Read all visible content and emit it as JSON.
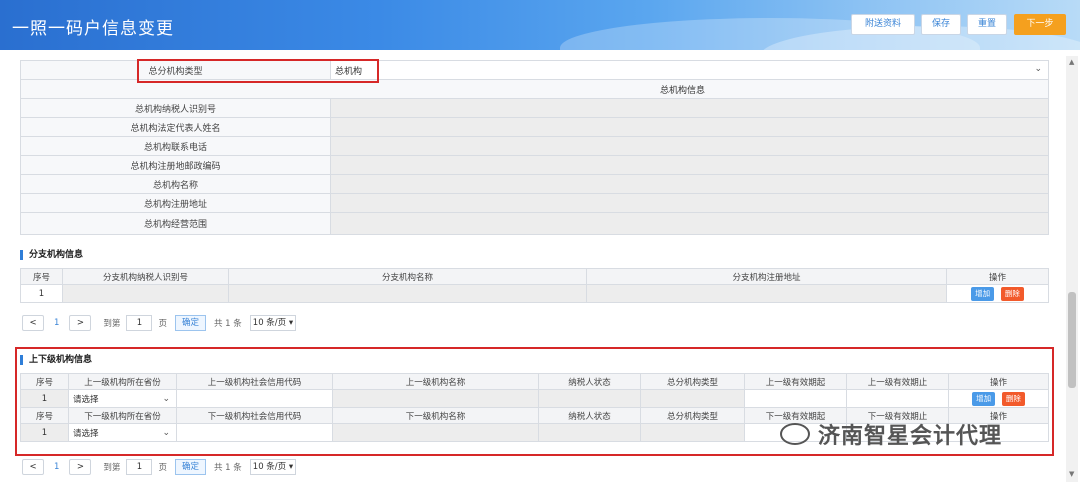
{
  "header": {
    "title": "一照一码户信息变更",
    "buttons": {
      "attach": "附送资料",
      "save": "保存",
      "reset": "重置",
      "next": "下一步"
    }
  },
  "head_office": {
    "type_label": "总分机构类型",
    "type_value": "总机构",
    "section_title": "总机构信息",
    "rows": [
      "总机构纳税人识别号",
      "总机构法定代表人姓名",
      "总机构联系电话",
      "总机构注册地邮政编码",
      "总机构名称",
      "总机构注册地址",
      "总机构经营范围"
    ]
  },
  "branch": {
    "title": "分支机构信息",
    "columns": [
      "序号",
      "分支机构纳税人识别号",
      "分支机构名称",
      "分支机构注册地址",
      "操作"
    ],
    "rows": [
      {
        "no": "1"
      }
    ],
    "add": "增加",
    "del": "删除"
  },
  "pager": {
    "page": "1",
    "goto_label": "到第",
    "goto_value": "1",
    "page_unit": "页",
    "confirm": "确定",
    "total": "共 1 条",
    "size": "10 条/页"
  },
  "relation": {
    "title": "上下级机构信息",
    "upper_columns": [
      "序号",
      "上一级机构所在省份",
      "上一级机构社会信用代码",
      "上一级机构名称",
      "纳税人状态",
      "总分机构类型",
      "上一级有效期起",
      "上一级有效期止",
      "操作"
    ],
    "lower_columns": [
      "序号",
      "下一级机构所在省份",
      "下一级机构社会信用代码",
      "下一级机构名称",
      "纳税人状态",
      "总分机构类型",
      "下一级有效期起",
      "下一级有效期止",
      "操作"
    ],
    "upper_row": {
      "no": "1",
      "province": "请选择"
    },
    "lower_row": {
      "no": "1",
      "province": "请选择"
    },
    "add": "增加",
    "del": "删除"
  },
  "watermark": "济南智星会计代理",
  "colors": {
    "accent": "#2f7ed8",
    "next_button": "#f5a01e",
    "delete": "#f25a2b",
    "highlight_box": "#d62828"
  }
}
